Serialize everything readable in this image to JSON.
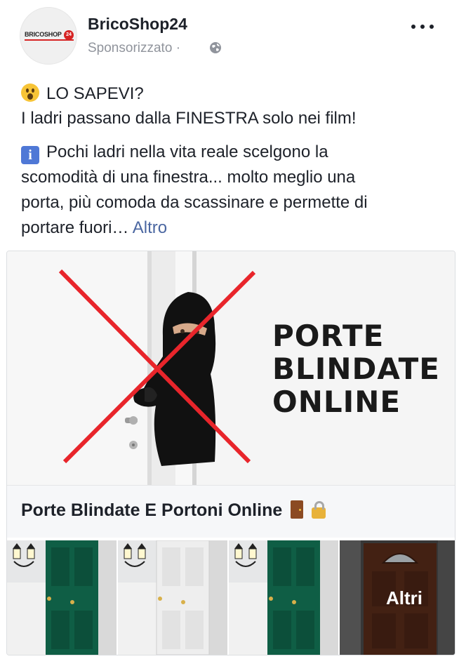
{
  "header": {
    "page_name": "BricoShop24",
    "sponsored_label": "Sponsorizzato",
    "separator": "·",
    "avatar_logo_text": "BRICOSHOP",
    "avatar_logo_number": "24"
  },
  "post": {
    "line1": "LO SAPEVI?",
    "line2": "I ladri passano dalla FINESTRA solo nei film!",
    "para2_line1": "Pochi ladri nella vita reale scelgono la",
    "para2_line2": "scomodità di una finestra... molto meglio una",
    "para2_line3": "porta, più comoda da scassinare e permette di",
    "para2_line4": "portare fuori…",
    "see_more": "Altro",
    "info_icon_glyph": "i"
  },
  "ad": {
    "hero_lines": [
      "PORTE",
      "BLINDATE",
      "ONLINE"
    ],
    "headline": "Porte Blindate E Portoni Online",
    "more_tile_label": "Altri",
    "colors": {
      "cross_red": "#e8252b",
      "door_green": "#0f5e45",
      "door_white": "#eeeeee",
      "door_brown": "#5a2c1a",
      "link": "#4b67a1"
    }
  }
}
